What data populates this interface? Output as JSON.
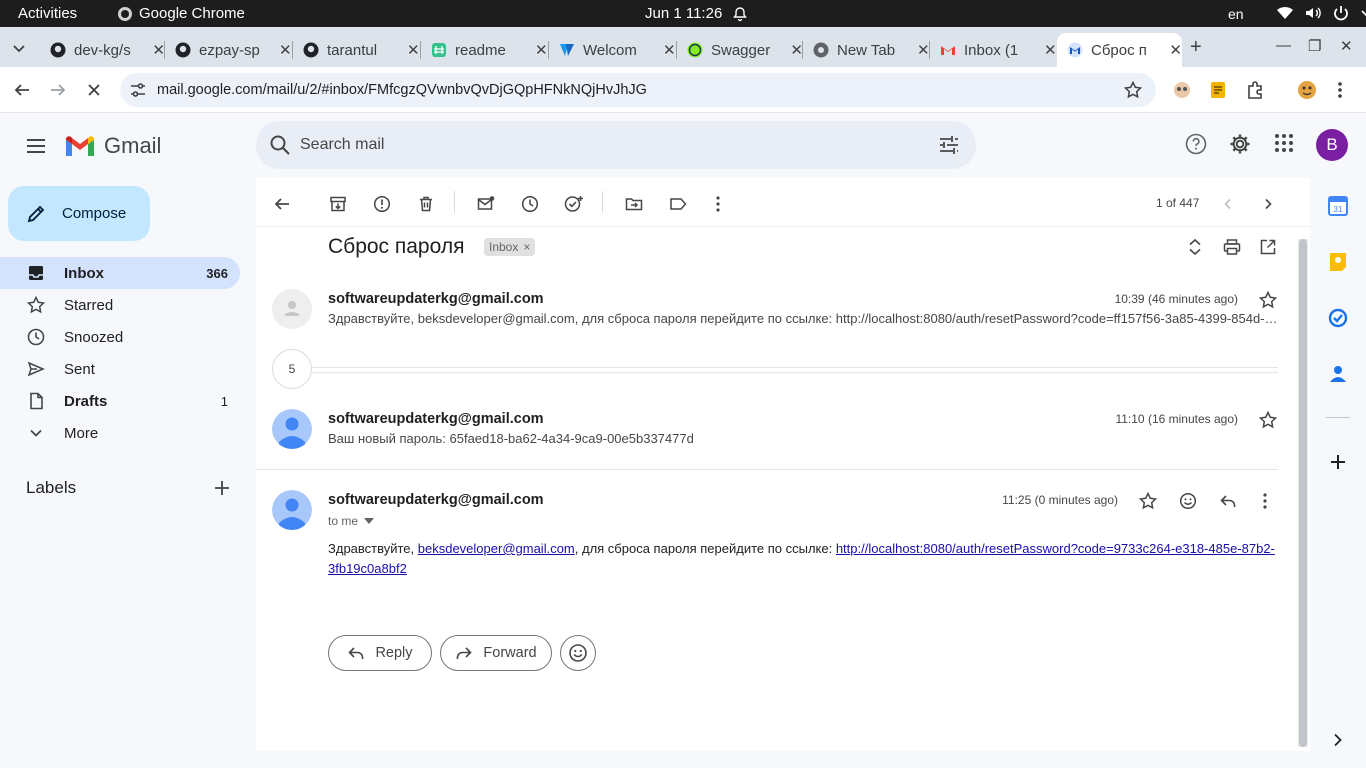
{
  "os": {
    "activities": "Activities",
    "app_name": "Google Chrome",
    "clock": "Jun 1  11:26",
    "lang": "en"
  },
  "tabs": [
    {
      "title": "dev-kg/s",
      "icon": "github-icon"
    },
    {
      "title": "ezpay-sp",
      "icon": "github-icon"
    },
    {
      "title": "tarantul",
      "icon": "github-icon"
    },
    {
      "title": "readme",
      "icon": "readme-icon"
    },
    {
      "title": "Welcom",
      "icon": "vuetify-icon"
    },
    {
      "title": "Swagger",
      "icon": "swagger-icon"
    },
    {
      "title": "New Tab",
      "icon": "chrome-icon"
    },
    {
      "title": "Inbox (1",
      "icon": "gmail-icon"
    },
    {
      "title": "Сброс п",
      "icon": "gmail-icon",
      "active": true
    }
  ],
  "address": {
    "url": "mail.google.com/mail/u/2/#inbox/FMfcgzQVwnbvQvDjGQpHFNkNQjHvJhJG"
  },
  "gmail": {
    "brand": "Gmail",
    "search_placeholder": "Search mail",
    "avatar_letter": "B",
    "accent": "#c2e7ff"
  },
  "sidebar": {
    "compose": "Compose",
    "items": [
      {
        "label": "Inbox",
        "count": "366"
      },
      {
        "label": "Starred",
        "count": ""
      },
      {
        "label": "Snoozed",
        "count": ""
      },
      {
        "label": "Sent",
        "count": ""
      },
      {
        "label": "Drafts",
        "count": "1"
      },
      {
        "label": "More",
        "count": ""
      }
    ],
    "labels_title": "Labels"
  },
  "thread": {
    "pager": "1 of 447",
    "subject": "Сброс пароля",
    "chip": "Inbox",
    "collapsed_count": "5",
    "messages": [
      {
        "sender": "softwareupdaterkg@gmail.com",
        "time": "10:39 (46 minutes ago)",
        "snippet": "Здравствуйте, beksdeveloper@gmail.com, для сброса пароля перейдите по ссылке: http://localhost:8080/auth/resetPassword?code=ff157f56-3a85-4399-854d-…"
      },
      {
        "sender": "softwareupdaterkg@gmail.com",
        "time": "11:10 (16 minutes ago)",
        "snippet": "Ваш новый пароль: 65faed18-ba62-4a34-9ca9-00e5b337477d"
      },
      {
        "sender": "softwareupdaterkg@gmail.com",
        "time": "11:25 (0 minutes ago)",
        "to": "to me",
        "body_prefix": "Здравствуйте, ",
        "body_email": "beksdeveloper@gmail.com",
        "body_middle": ", для сброса пароля перейдите по ссылке: ",
        "body_link": "http://localhost:8080/auth/resetPassword?code=9733c264-e318-485e-87b2-3fb19c0a8bf2"
      }
    ],
    "reply": "Reply",
    "forward": "Forward"
  }
}
